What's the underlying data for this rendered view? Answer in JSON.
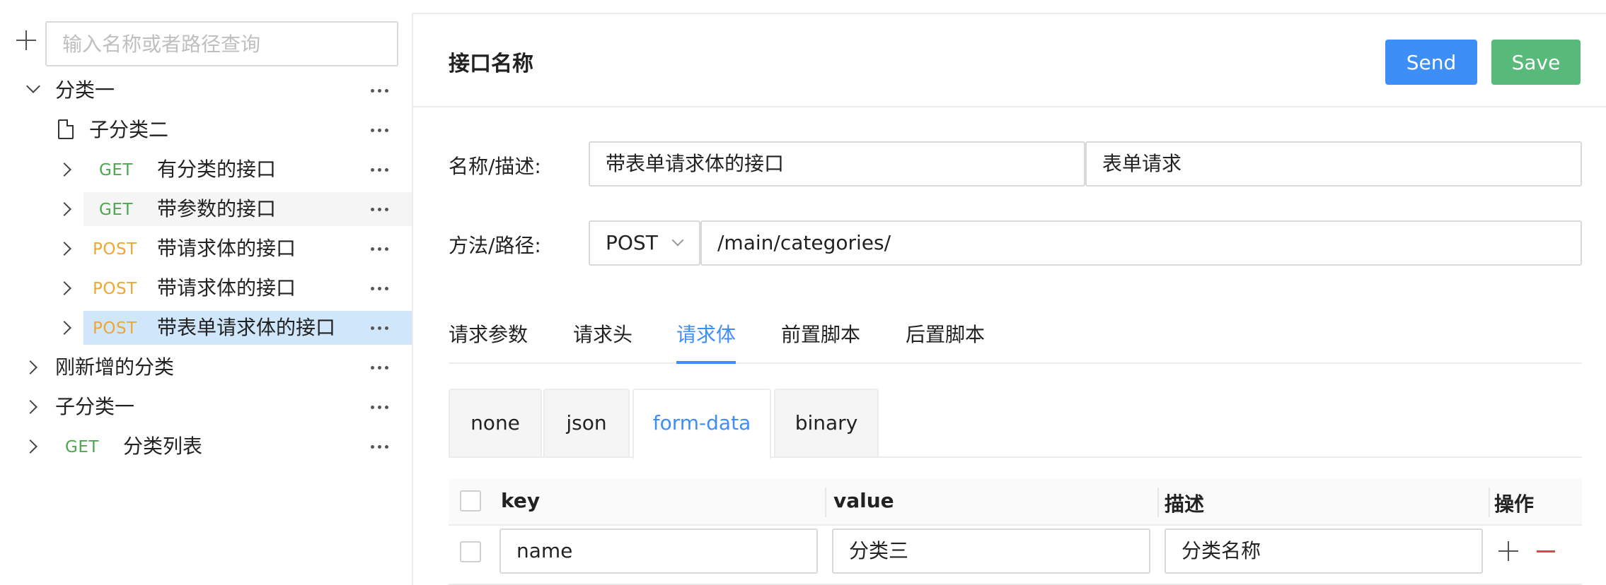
{
  "sidebar": {
    "search_placeholder": "输入名称或者路径查询",
    "tree": [
      {
        "label": "分类一",
        "type": "folder",
        "expanded": true
      },
      {
        "label": "子分类二",
        "type": "file"
      },
      {
        "label": "有分类的接口",
        "method": "GET"
      },
      {
        "label": "带参数的接口",
        "method": "GET"
      },
      {
        "label": "带请求体的接口",
        "method": "POST"
      },
      {
        "label": "带请求体的接口",
        "method": "POST"
      },
      {
        "label": "带表单请求体的接口",
        "method": "POST",
        "selected": true
      },
      {
        "label": "刚新增的分类",
        "type": "folder"
      },
      {
        "label": "子分类一",
        "type": "folder"
      },
      {
        "label": "分类列表",
        "method": "GET"
      }
    ]
  },
  "header": {
    "title": "接口名称",
    "send_label": "Send",
    "save_label": "Save"
  },
  "form": {
    "name_label": "名称/描述:",
    "name_value": "带表单请求体的接口",
    "desc_value": "表单请求",
    "method_label": "方法/路径:",
    "method_value": "POST",
    "path_value": "/main/categories/"
  },
  "tabs": [
    {
      "label": "请求参数"
    },
    {
      "label": "请求头"
    },
    {
      "label": "请求体",
      "active": true
    },
    {
      "label": "前置脚本"
    },
    {
      "label": "后置脚本"
    }
  ],
  "body_types": [
    {
      "label": "none"
    },
    {
      "label": "json"
    },
    {
      "label": "form-data",
      "active": true
    },
    {
      "label": "binary"
    }
  ],
  "table": {
    "columns": [
      "key",
      "value",
      "描述",
      "操作"
    ],
    "rows": [
      {
        "key": "name",
        "value": "分类三",
        "desc": "分类名称"
      }
    ]
  },
  "colors": {
    "primary": "#3e8ef7",
    "save": "#57b97a",
    "get": "#4aa84f",
    "post": "#f0a732",
    "delete": "#e2473c",
    "selected_row": "#cfe6fb"
  }
}
